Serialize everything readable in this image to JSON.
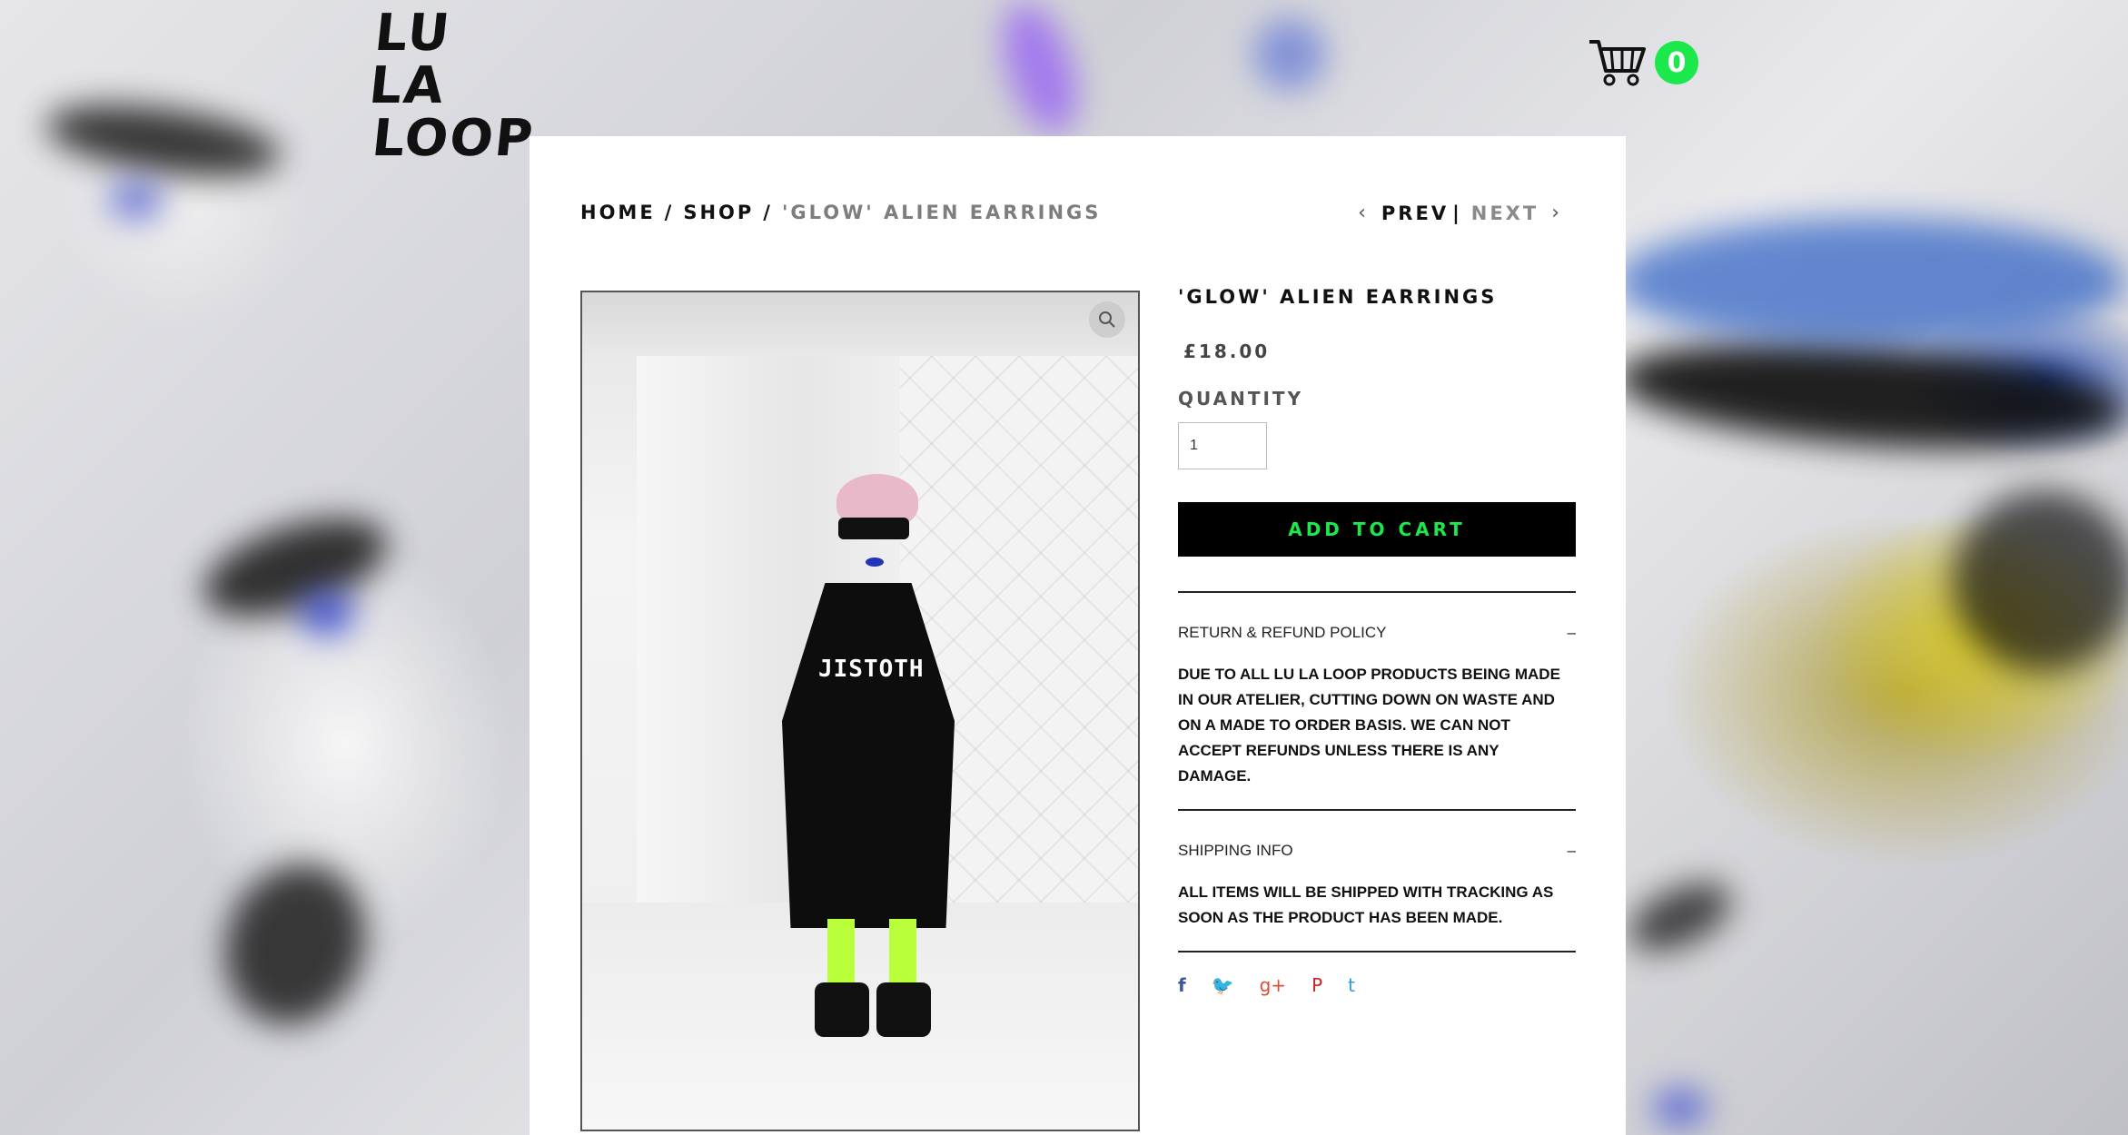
{
  "logo": {
    "line1": "LU LA",
    "line2": "LOOP"
  },
  "cart": {
    "count": "0",
    "icon": "cart-icon"
  },
  "breadcrumb": {
    "home": "HOME",
    "shop": "SHOP",
    "separator": "/",
    "current": "'GLOW' ALIEN EARRINGS"
  },
  "pager": {
    "prev": "PREV",
    "divider": "|",
    "next": "NEXT"
  },
  "product": {
    "title": "'GLOW' ALIEN EARRINGS",
    "price": "£18.00",
    "quantity_label": "QUANTITY",
    "quantity_value": "1",
    "add_to_cart": "ADD TO CART",
    "image_shirt_text": "JISTOTH"
  },
  "accordion": [
    {
      "title": "RETURN & REFUND POLICY",
      "toggle": "–",
      "body": "DUE TO ALL LU LA LOOP PRODUCTS BEING MADE IN OUR ATELIER, CUTTING DOWN ON WASTE AND ON A MADE TO ORDER BASIS. WE CAN NOT ACCEPT REFUNDS UNLESS THERE IS ANY DAMAGE."
    },
    {
      "title": "SHIPPING INFO",
      "toggle": "–",
      "body": "ALL ITEMS WILL BE SHIPPED WITH TRACKING AS SOON AS THE PRODUCT HAS BEEN MADE."
    }
  ],
  "share": {
    "facebook": "f",
    "twitter": "🐦",
    "googleplus": "g+",
    "pinterest": "P",
    "tumblr": "t"
  },
  "colors": {
    "accent": "#1be84a",
    "button_bg": "#000000",
    "text": "#111111"
  }
}
